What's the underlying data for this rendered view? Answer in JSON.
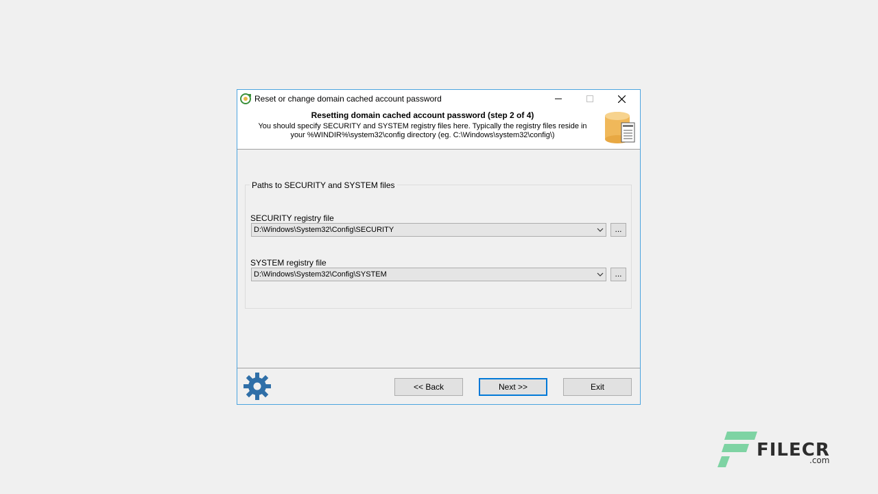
{
  "window": {
    "title": "Reset or change domain cached account password"
  },
  "header": {
    "title": "Resetting domain cached account password (step 2 of 4)",
    "description": "You should specify SECURITY and SYSTEM registry files here. Typically the registry files reside in your %WINDIR%\\system32\\config directory (eg. C:\\Windows\\system32\\config\\)"
  },
  "group": {
    "legend": "Paths to SECURITY and SYSTEM files",
    "security_label": "SECURITY registry file",
    "security_value": "D:\\Windows\\System32\\Config\\SECURITY",
    "system_label": "SYSTEM registry file",
    "system_value": "D:\\Windows\\System32\\Config\\SYSTEM",
    "browse_label": "..."
  },
  "footer": {
    "back_label": "<< Back",
    "next_label": "Next >>",
    "exit_label": "Exit"
  },
  "watermark": {
    "brand": "FILECR",
    "suffix": ".com"
  },
  "colors": {
    "window_border": "#4aa3df",
    "default_button_border": "#0078d7",
    "gear": "#2f6fa8",
    "database": "#f0b85a",
    "watermark_green": "#7ed3a3"
  },
  "icons": {
    "app": "refresh-key-icon",
    "header": "database-registry-icon",
    "footer": "gear-icon"
  }
}
